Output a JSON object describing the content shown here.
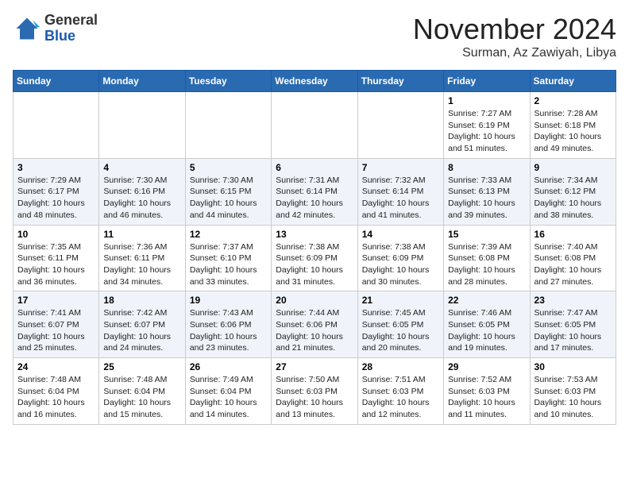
{
  "header": {
    "logo": {
      "line1": "General",
      "line2": "Blue"
    },
    "title": "November 2024",
    "location": "Surman, Az Zawiyah, Libya"
  },
  "calendar": {
    "weekdays": [
      "Sunday",
      "Monday",
      "Tuesday",
      "Wednesday",
      "Thursday",
      "Friday",
      "Saturday"
    ],
    "weeks": [
      [
        {
          "day": "",
          "info": ""
        },
        {
          "day": "",
          "info": ""
        },
        {
          "day": "",
          "info": ""
        },
        {
          "day": "",
          "info": ""
        },
        {
          "day": "",
          "info": ""
        },
        {
          "day": "1",
          "info": "Sunrise: 7:27 AM\nSunset: 6:19 PM\nDaylight: 10 hours\nand 51 minutes."
        },
        {
          "day": "2",
          "info": "Sunrise: 7:28 AM\nSunset: 6:18 PM\nDaylight: 10 hours\nand 49 minutes."
        }
      ],
      [
        {
          "day": "3",
          "info": "Sunrise: 7:29 AM\nSunset: 6:17 PM\nDaylight: 10 hours\nand 48 minutes."
        },
        {
          "day": "4",
          "info": "Sunrise: 7:30 AM\nSunset: 6:16 PM\nDaylight: 10 hours\nand 46 minutes."
        },
        {
          "day": "5",
          "info": "Sunrise: 7:30 AM\nSunset: 6:15 PM\nDaylight: 10 hours\nand 44 minutes."
        },
        {
          "day": "6",
          "info": "Sunrise: 7:31 AM\nSunset: 6:14 PM\nDaylight: 10 hours\nand 42 minutes."
        },
        {
          "day": "7",
          "info": "Sunrise: 7:32 AM\nSunset: 6:14 PM\nDaylight: 10 hours\nand 41 minutes."
        },
        {
          "day": "8",
          "info": "Sunrise: 7:33 AM\nSunset: 6:13 PM\nDaylight: 10 hours\nand 39 minutes."
        },
        {
          "day": "9",
          "info": "Sunrise: 7:34 AM\nSunset: 6:12 PM\nDaylight: 10 hours\nand 38 minutes."
        }
      ],
      [
        {
          "day": "10",
          "info": "Sunrise: 7:35 AM\nSunset: 6:11 PM\nDaylight: 10 hours\nand 36 minutes."
        },
        {
          "day": "11",
          "info": "Sunrise: 7:36 AM\nSunset: 6:11 PM\nDaylight: 10 hours\nand 34 minutes."
        },
        {
          "day": "12",
          "info": "Sunrise: 7:37 AM\nSunset: 6:10 PM\nDaylight: 10 hours\nand 33 minutes."
        },
        {
          "day": "13",
          "info": "Sunrise: 7:38 AM\nSunset: 6:09 PM\nDaylight: 10 hours\nand 31 minutes."
        },
        {
          "day": "14",
          "info": "Sunrise: 7:38 AM\nSunset: 6:09 PM\nDaylight: 10 hours\nand 30 minutes."
        },
        {
          "day": "15",
          "info": "Sunrise: 7:39 AM\nSunset: 6:08 PM\nDaylight: 10 hours\nand 28 minutes."
        },
        {
          "day": "16",
          "info": "Sunrise: 7:40 AM\nSunset: 6:08 PM\nDaylight: 10 hours\nand 27 minutes."
        }
      ],
      [
        {
          "day": "17",
          "info": "Sunrise: 7:41 AM\nSunset: 6:07 PM\nDaylight: 10 hours\nand 25 minutes."
        },
        {
          "day": "18",
          "info": "Sunrise: 7:42 AM\nSunset: 6:07 PM\nDaylight: 10 hours\nand 24 minutes."
        },
        {
          "day": "19",
          "info": "Sunrise: 7:43 AM\nSunset: 6:06 PM\nDaylight: 10 hours\nand 23 minutes."
        },
        {
          "day": "20",
          "info": "Sunrise: 7:44 AM\nSunset: 6:06 PM\nDaylight: 10 hours\nand 21 minutes."
        },
        {
          "day": "21",
          "info": "Sunrise: 7:45 AM\nSunset: 6:05 PM\nDaylight: 10 hours\nand 20 minutes."
        },
        {
          "day": "22",
          "info": "Sunrise: 7:46 AM\nSunset: 6:05 PM\nDaylight: 10 hours\nand 19 minutes."
        },
        {
          "day": "23",
          "info": "Sunrise: 7:47 AM\nSunset: 6:05 PM\nDaylight: 10 hours\nand 17 minutes."
        }
      ],
      [
        {
          "day": "24",
          "info": "Sunrise: 7:48 AM\nSunset: 6:04 PM\nDaylight: 10 hours\nand 16 minutes."
        },
        {
          "day": "25",
          "info": "Sunrise: 7:48 AM\nSunset: 6:04 PM\nDaylight: 10 hours\nand 15 minutes."
        },
        {
          "day": "26",
          "info": "Sunrise: 7:49 AM\nSunset: 6:04 PM\nDaylight: 10 hours\nand 14 minutes."
        },
        {
          "day": "27",
          "info": "Sunrise: 7:50 AM\nSunset: 6:03 PM\nDaylight: 10 hours\nand 13 minutes."
        },
        {
          "day": "28",
          "info": "Sunrise: 7:51 AM\nSunset: 6:03 PM\nDaylight: 10 hours\nand 12 minutes."
        },
        {
          "day": "29",
          "info": "Sunrise: 7:52 AM\nSunset: 6:03 PM\nDaylight: 10 hours\nand 11 minutes."
        },
        {
          "day": "30",
          "info": "Sunrise: 7:53 AM\nSunset: 6:03 PM\nDaylight: 10 hours\nand 10 minutes."
        }
      ]
    ]
  }
}
